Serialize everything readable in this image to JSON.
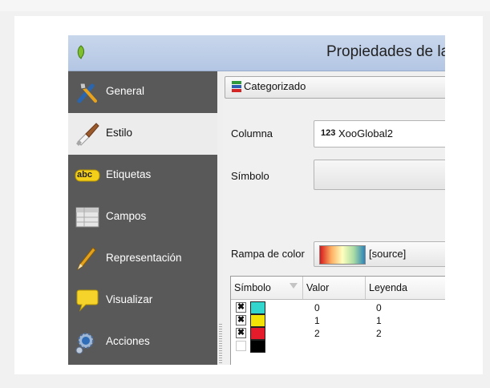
{
  "window": {
    "title": "Propiedades de la"
  },
  "sidebar": {
    "items": [
      {
        "label": "General",
        "icon": "tools-icon"
      },
      {
        "label": "Estilo",
        "icon": "paintbrush-icon",
        "active": true
      },
      {
        "label": "Etiquetas",
        "icon": "abc-label-icon",
        "badge": "abc"
      },
      {
        "label": "Campos",
        "icon": "table-icon"
      },
      {
        "label": "Representación",
        "icon": "pen-icon"
      },
      {
        "label": "Visualizar",
        "icon": "speech-bubble-icon"
      },
      {
        "label": "Acciones",
        "icon": "gears-icon"
      }
    ]
  },
  "style": {
    "renderer": "Categorizado",
    "column_label": "Columna",
    "column_type": "123",
    "column_value": "XooGlobal2",
    "symbol_label": "Símbolo",
    "ramp_label": "Rampa de color",
    "ramp_value": "[source]"
  },
  "table": {
    "headers": [
      "Símbolo",
      "Valor",
      "Leyenda"
    ],
    "rows": [
      {
        "checked": true,
        "color": "#33d6cc",
        "value": "0",
        "legend": "0"
      },
      {
        "checked": true,
        "color": "#f2e205",
        "value": "1",
        "legend": "1"
      },
      {
        "checked": true,
        "color": "#e41b2b",
        "value": "2",
        "legend": "2"
      },
      {
        "checked": false,
        "color": "#000000",
        "value": "",
        "legend": ""
      }
    ]
  },
  "colors": {
    "sidebar_bg": "#595959",
    "titlebar": "#b3c6e3"
  }
}
